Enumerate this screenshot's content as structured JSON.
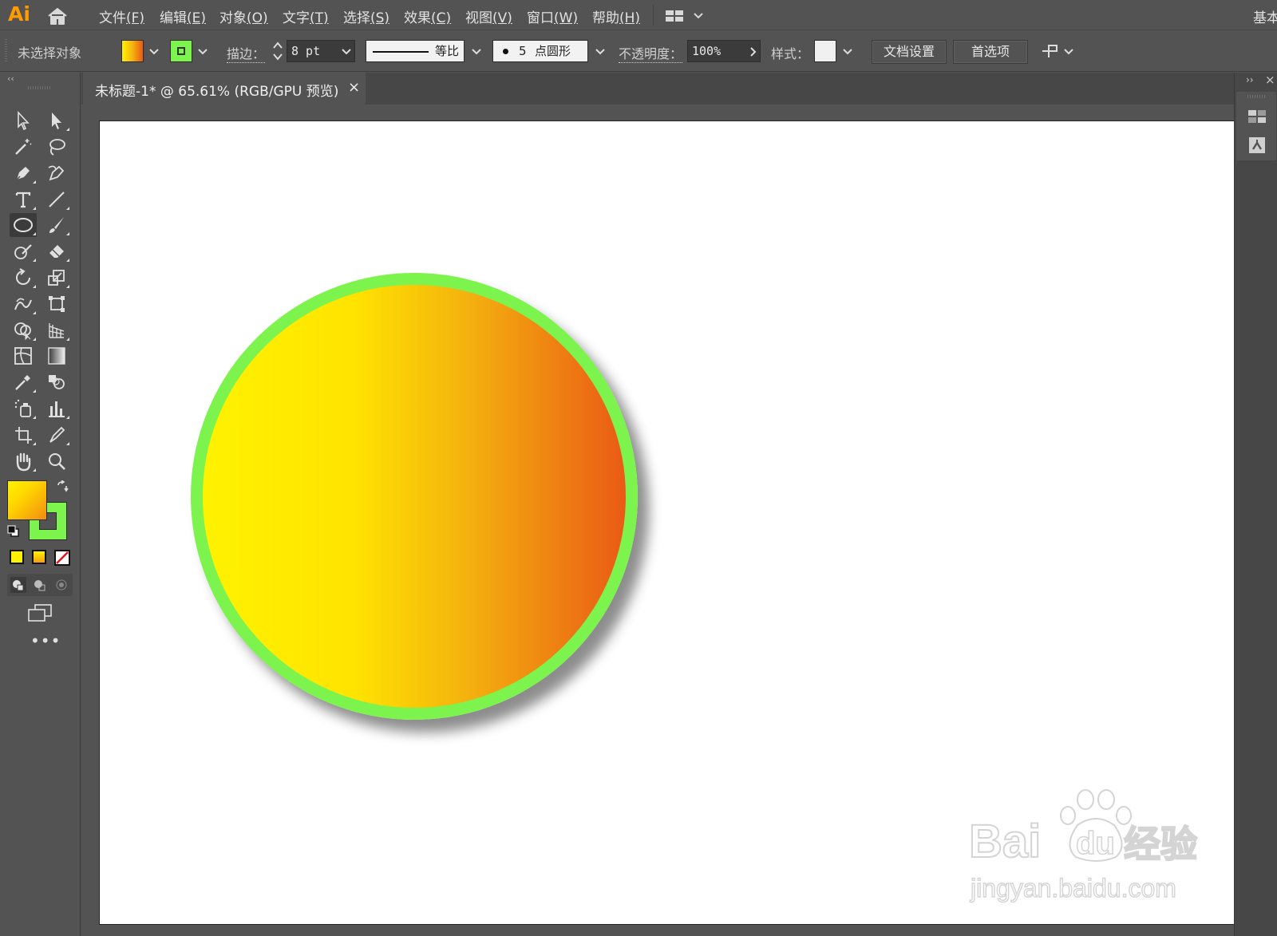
{
  "app": {
    "logo": "Ai"
  },
  "menu": {
    "items": [
      {
        "label": "文件",
        "key": "(F)"
      },
      {
        "label": "编辑",
        "key": "(E)"
      },
      {
        "label": "对象",
        "key": "(O)"
      },
      {
        "label": "文字",
        "key": "(T)"
      },
      {
        "label": "选择",
        "key": "(S)"
      },
      {
        "label": "效果",
        "key": "(C)"
      },
      {
        "label": "视图",
        "key": "(V)"
      },
      {
        "label": "窗口",
        "key": "(W)"
      },
      {
        "label": "帮助",
        "key": "(H)"
      }
    ],
    "workspace_label": "基本"
  },
  "control_bar": {
    "selection_status": "未选择对象",
    "stroke_label": "描边：",
    "stroke_weight": "8 pt",
    "profile_label": "等比",
    "brush_size": "5",
    "brush_label": "点圆形",
    "opacity_label": "不透明度：",
    "opacity_value": "100%",
    "style_label": "样式：",
    "doc_setup_button": "文档设置",
    "preferences_button": "首选项"
  },
  "document": {
    "tab_title": "未标题-1* @ 65.61% (RGB/GPU 预览)",
    "close_glyph": "×"
  },
  "artwork": {
    "fill_gradient": [
      "#fff200",
      "#ffe400",
      "#f4b30e",
      "#ea5a15"
    ],
    "stroke_color": "#7df44e",
    "stroke_weight_pt": 8
  },
  "colors": {
    "ui_bg": "#535353",
    "ui_dark": "#474747",
    "accent_logo": "#ff9a00",
    "stroke_swatch": "#7df44e"
  },
  "watermark": {
    "brand": "Bai",
    "brand_paw": "du",
    "brand_suffix": "经验",
    "url": "jingyan.baidu.com"
  },
  "icons": {
    "toolbar": [
      "selection-icon",
      "direct-selection-icon",
      "magic-wand-icon",
      "lasso-icon",
      "pen-icon",
      "curvature-icon",
      "type-icon",
      "line-segment-icon",
      "ellipse-icon",
      "paintbrush-icon",
      "shaper-icon",
      "eraser-icon",
      "rotate-icon",
      "scale-icon",
      "warp-icon",
      "free-transform-icon",
      "shape-builder-icon",
      "perspective-grid-icon",
      "mesh-icon",
      "gradient-icon",
      "eyedropper-icon",
      "blend-icon",
      "symbol-sprayer-icon",
      "column-graph-icon",
      "artboard-icon",
      "slice-icon",
      "hand-icon",
      "zoom-icon"
    ]
  }
}
